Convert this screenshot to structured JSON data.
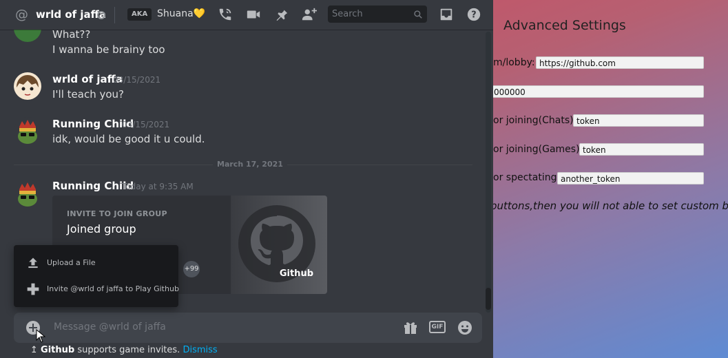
{
  "background_app": {
    "title": "Advanced Settings",
    "rows": [
      {
        "label": "m/lobby:",
        "value": "https://github.com"
      },
      {
        "label": "",
        "value": "000000"
      },
      {
        "label": "or joining(Chats):",
        "value": "token"
      },
      {
        "label": "or joining(Games):",
        "value": "token"
      },
      {
        "label": "or spectating:",
        "value": "another_token"
      }
    ],
    "note": "buttons,then you will not able to set custom button"
  },
  "header": {
    "at_symbol": "@",
    "channel_name": "wrld of jaffa",
    "aka_badge": "AKA",
    "nickname": "Shuana💛",
    "search_placeholder": "Search"
  },
  "messages": [
    {
      "lines": [
        "What??",
        "I wanna be brainy too"
      ]
    },
    {
      "author": "wrld of jaffa",
      "timestamp": "03/15/2021",
      "text": "I'll teach you?"
    },
    {
      "author": "Running Child",
      "timestamp": "03/15/2021",
      "text": "idk, would be good it u could."
    }
  ],
  "date_divider": "March 17, 2021",
  "invite_message": {
    "author": "Running Child",
    "timestamp": "Today at 9:35 AM",
    "kicker": "INVITE TO JOIN GROUP",
    "title": "Joined group",
    "member_count": "+99",
    "game": "Github"
  },
  "attach_menu": {
    "items": [
      {
        "label": "Upload a File",
        "icon": "upload-icon"
      },
      {
        "label": "Invite @wrld of jaffa to Play Github",
        "icon": "gamepad-icon"
      }
    ]
  },
  "composer": {
    "placeholder": "Message @wrld of jaffa",
    "gif_label": "GIF"
  },
  "notice": {
    "game": "Github",
    "text": " supports game invites. ",
    "dismiss": "Dismiss"
  },
  "colors": {
    "discord_bg": "#36393f",
    "link": "#00b0f4"
  }
}
